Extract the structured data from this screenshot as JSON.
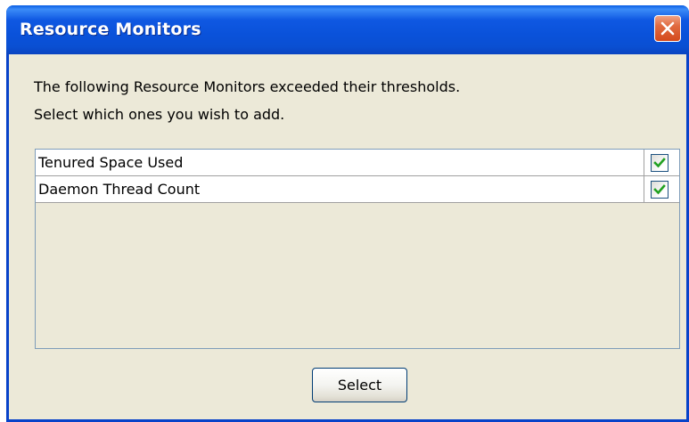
{
  "window": {
    "title": "Resource Monitors"
  },
  "message": {
    "line1": "The following Resource Monitors exceeded their thresholds.",
    "line2": "Select which ones you wish to add."
  },
  "monitors": [
    {
      "label": "Tenured Space Used",
      "checked": true
    },
    {
      "label": "Daemon Thread Count",
      "checked": true
    }
  ],
  "buttons": {
    "select_label": "Select"
  },
  "icons": {
    "close": "close-icon",
    "checkbox": "check-icon"
  },
  "colors": {
    "titlebar": "#0a52da",
    "dialog_bg": "#ece9d8",
    "close_button": "#d44a1c",
    "check_mark": "#21a121"
  }
}
